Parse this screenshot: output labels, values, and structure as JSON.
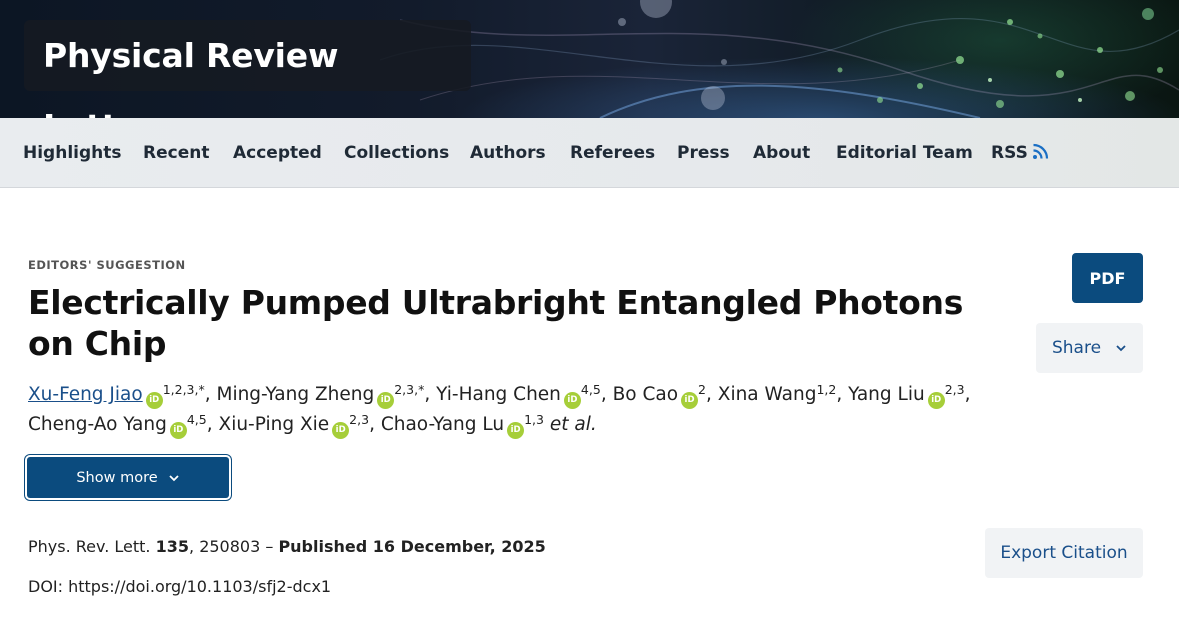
{
  "journal": {
    "title": "Physical Review Letters"
  },
  "nav": {
    "items": [
      "Highlights",
      "Recent",
      "Accepted",
      "Collections",
      "Authors",
      "Referees",
      "Press",
      "About",
      "Editorial Team",
      "RSS"
    ]
  },
  "article": {
    "kicker": "EDITORS' SUGGESTION",
    "title": "Electrically Pumped Ultrabright Entangled Photons on Chip",
    "authors": [
      {
        "name": "Xu-Feng Jiao",
        "affil": "1,2,3,*",
        "link": true
      },
      {
        "name": "Ming-Yang Zheng",
        "affil": "2,3,*"
      },
      {
        "name": "Yi-Hang Chen",
        "affil": "4,5"
      },
      {
        "name": "Bo Cao",
        "affil": "2"
      },
      {
        "name": "Xina Wang",
        "affil": "1,2",
        "no_orcid": true
      },
      {
        "name": "Yang Liu",
        "affil": "2,3"
      },
      {
        "name": "Cheng-Ao Yang",
        "affil": "4,5"
      },
      {
        "name": "Xiu-Ping Xie",
        "affil": "2,3"
      },
      {
        "name": "Chao-Yang Lu",
        "affil": "1,3"
      }
    ],
    "et_al": "et al.",
    "orcid_label": "iD",
    "show_more_label": "Show more",
    "citation": {
      "journal_abbrev": "Phys. Rev. Lett.",
      "volume": "135",
      "article_number": ", 250803 – ",
      "published": "Published 16 December, 2025"
    },
    "doi": "DOI: https://doi.org/10.1103/sfj2-dcx1"
  },
  "actions": {
    "pdf_label": "PDF",
    "share_label": "Share",
    "export_label": "Export Citation"
  },
  "colors": {
    "brand_blue": "#0b4b7e",
    "link_blue": "#1a4f8a",
    "orcid_green": "#a6ce39",
    "rss_blue": "#1a6fc4"
  }
}
